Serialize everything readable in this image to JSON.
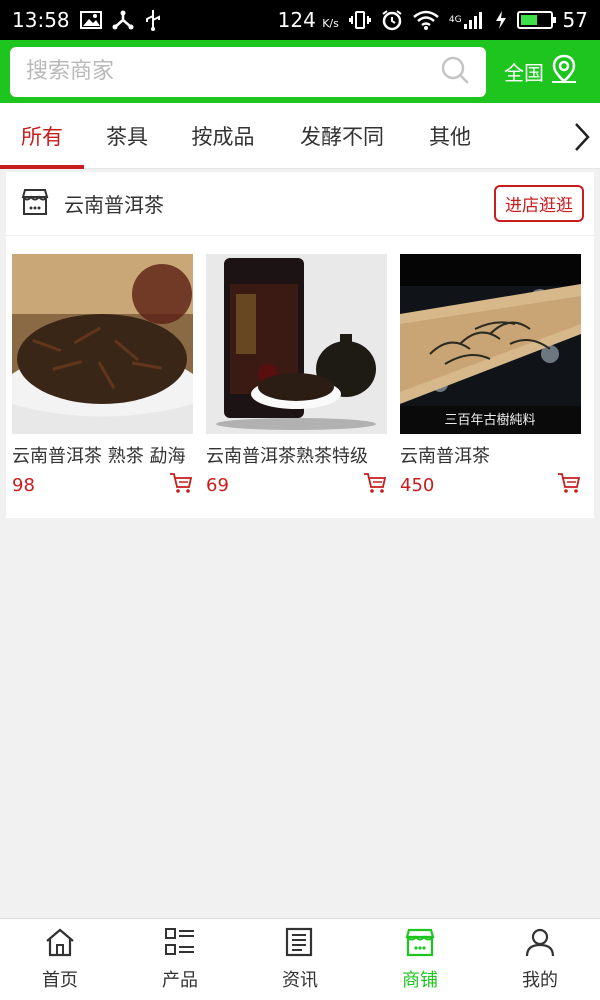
{
  "status_bar": {
    "time": "13:58",
    "speed": "124",
    "speed_unit": "K/s",
    "battery_pct": "57",
    "battery_level": 0.57,
    "net_type": "4G"
  },
  "search": {
    "placeholder": "搜索商家",
    "region_label": "全国"
  },
  "tabs": [
    {
      "label": "所有",
      "active": true
    },
    {
      "label": "茶具",
      "active": false
    },
    {
      "label": "按成品",
      "active": false
    },
    {
      "label": "发酵不同",
      "active": false
    },
    {
      "label": "其他",
      "active": false
    }
  ],
  "shop": {
    "name": "云南普洱茶",
    "visit_label": "进店逛逛",
    "products": [
      {
        "title": "云南普洱茶 熟茶 勐海",
        "price": "98"
      },
      {
        "title": "云南普洱茶熟茶特级",
        "price": "69"
      },
      {
        "title": "云南普洱茶",
        "price": "450",
        "image_caption": "三百年古樹純料"
      }
    ]
  },
  "bottom_nav": [
    {
      "label": "首页",
      "icon": "home-icon",
      "active": false
    },
    {
      "label": "产品",
      "icon": "grid-list-icon",
      "active": false
    },
    {
      "label": "资讯",
      "icon": "news-icon",
      "active": false
    },
    {
      "label": "商铺",
      "icon": "shop-icon",
      "active": true
    },
    {
      "label": "我的",
      "icon": "user-icon",
      "active": false
    }
  ],
  "colors": {
    "brand_green": "#1ec51e",
    "accent_red": "#c81d1d"
  }
}
